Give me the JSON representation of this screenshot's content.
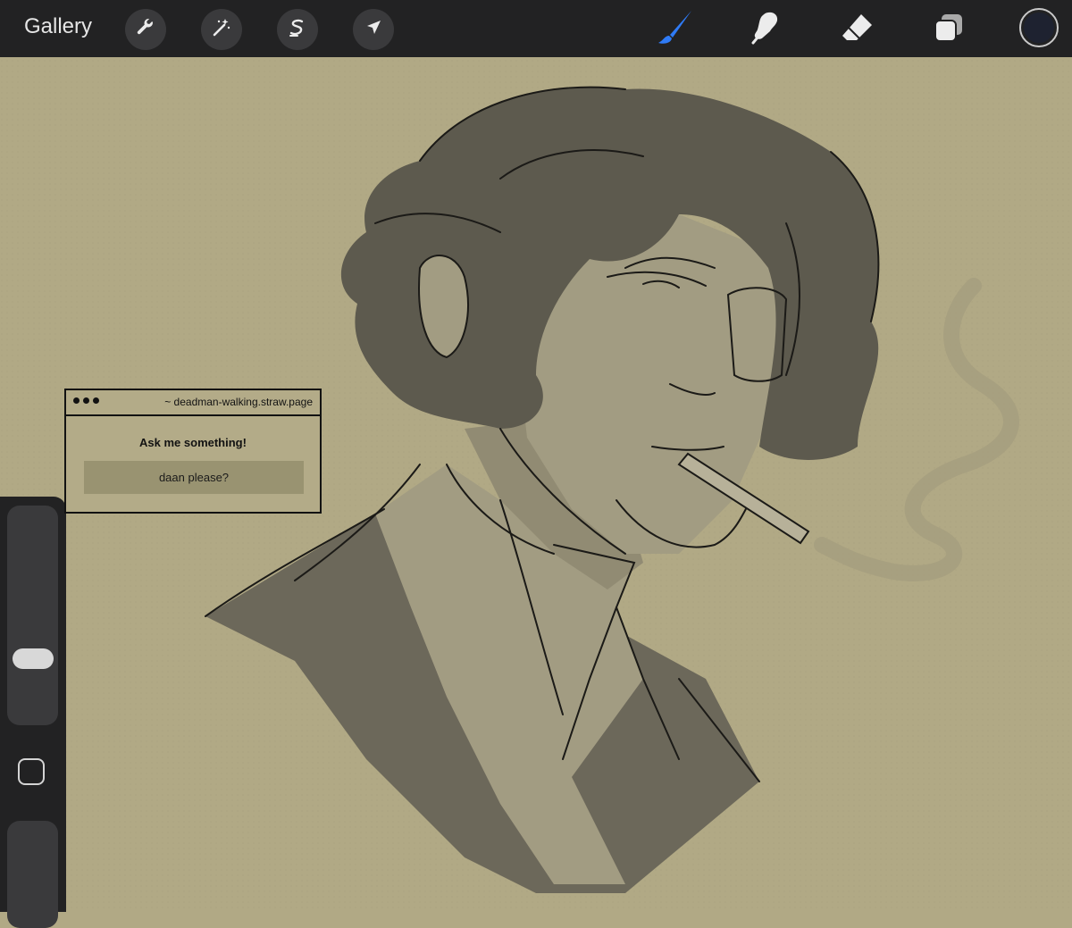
{
  "toolbar": {
    "gallery_label": "Gallery",
    "left_tools": [
      "wrench-icon",
      "magic-wand-icon",
      "selection-icon",
      "transform-arrow-icon"
    ],
    "right_tools": [
      "brush-icon",
      "smudge-icon",
      "eraser-icon",
      "layers-icon"
    ],
    "active_tool": "brush",
    "accent_color": "#2f7bf6",
    "current_color": "#1e2230"
  },
  "widget": {
    "url": "~ deadman-walking.straw.page",
    "title": "Ask me something!",
    "input_value": "daan please?"
  },
  "colors": {
    "canvas": "#b1a985",
    "chrome": "#222223"
  }
}
